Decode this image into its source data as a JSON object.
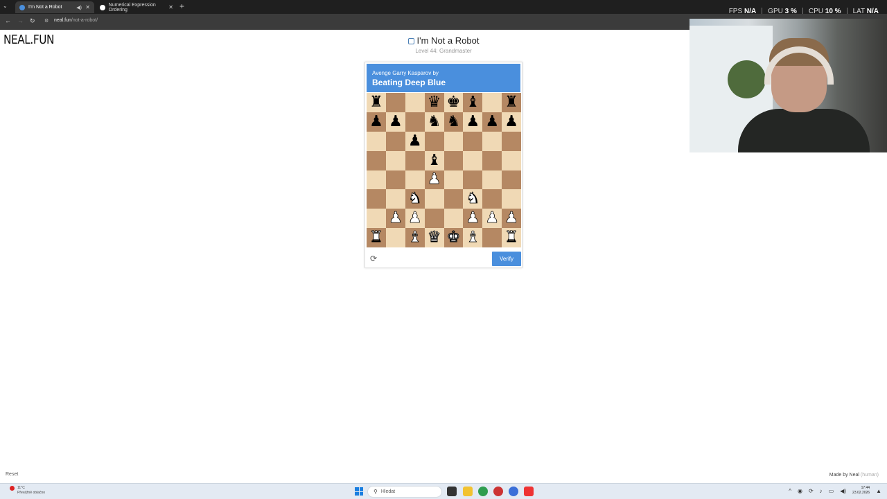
{
  "browser": {
    "tabs": [
      {
        "label": "I'm Not a Robot",
        "active": true
      },
      {
        "label": "Numerical Expression Ordering",
        "active": false
      }
    ],
    "url_host": "neal.fun",
    "url_path": "/not-a-robot/"
  },
  "overlay": {
    "fps_label": "FPS",
    "fps_value": "N/A",
    "gpu_label": "GPU",
    "gpu_value": "3",
    "cpu_label": "CPU",
    "cpu_value": "10",
    "lat_label": "LAT",
    "lat_value": "N/A"
  },
  "page": {
    "logo": "NEAL.FUN",
    "title": "I'm Not a Robot",
    "subtitle": "Level 44: Grandmaster",
    "reset_label": "Reset",
    "made_by": "Made by Neal",
    "made_by_lang": "(human)"
  },
  "captcha": {
    "header_small": "Avenge Garry Kasparov by",
    "header_big": "Beating Deep Blue",
    "verify_label": "Verify",
    "board": [
      [
        "bR",
        "",
        "",
        "bQ",
        "bK",
        "bB",
        "",
        "bR"
      ],
      [
        "bP",
        "bP",
        "",
        "bN",
        "bN",
        "bP",
        "bP",
        "bP"
      ],
      [
        "",
        "",
        "bP",
        "",
        "",
        "",
        "",
        ""
      ],
      [
        "",
        "",
        "",
        "bB",
        "",
        "",
        "",
        ""
      ],
      [
        "",
        "",
        "",
        "wP",
        "",
        "",
        "",
        ""
      ],
      [
        "",
        "",
        "wN",
        "",
        "",
        "wN",
        "",
        ""
      ],
      [
        "",
        "wP",
        "wP",
        "",
        "",
        "wP",
        "wP",
        "wP"
      ],
      [
        "wR",
        "",
        "wB",
        "wQ",
        "wK",
        "wB",
        "",
        "wR"
      ]
    ]
  },
  "taskbar": {
    "weather_temp": "11°C",
    "weather_desc": "Převážně oblačno",
    "search_placeholder": "Hledat",
    "time": "17:44",
    "date": "23.02.2026"
  },
  "colors": {
    "accent": "#4a8fdd",
    "board_light": "#f0d9b5",
    "board_dark": "#b58863"
  }
}
